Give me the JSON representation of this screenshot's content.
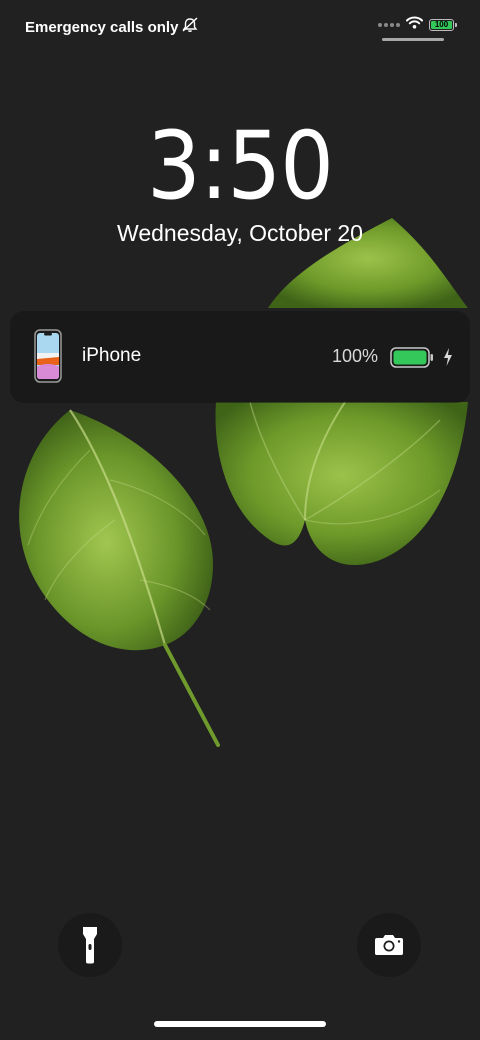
{
  "status_bar": {
    "carrier_text": "Emergency calls only",
    "battery_level": "100"
  },
  "lock_screen": {
    "time": "3:50",
    "date": "Wednesday, October 20"
  },
  "battery_widget": {
    "device_name": "iPhone",
    "battery_percent": "100%",
    "battery_fill_fraction": 1.0,
    "charging": true
  },
  "icons": {
    "no_alarm": "bell-slash-icon",
    "wifi": "wifi-icon",
    "flashlight": "flashlight-icon",
    "camera": "camera-icon",
    "charging": "bolt-icon"
  },
  "colors": {
    "background": "#212121",
    "battery_green": "#34c759",
    "leaf_green": "#6f9a2c"
  }
}
